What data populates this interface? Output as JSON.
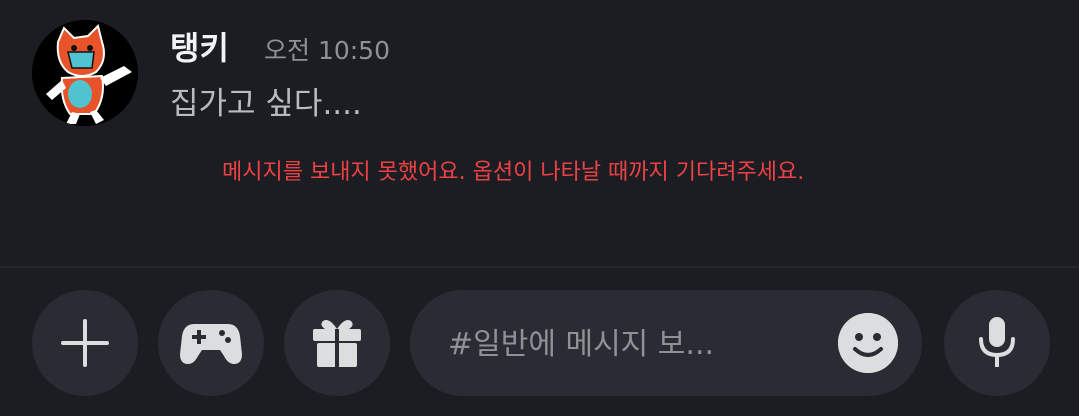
{
  "message": {
    "author": "탱키",
    "timestamp": "오전 10:50",
    "content": "집가고 싶다....",
    "error": "메시지를 보내지 못했어요. 옵션이 나타날 때까지 기다려주세요."
  },
  "composer": {
    "placeholder": "#일반에 메시지 보..."
  },
  "icons": {
    "add": "plus-icon",
    "games": "gamepad-icon",
    "gift": "gift-icon",
    "emoji": "smiley-icon",
    "voice": "microphone-icon"
  },
  "colors": {
    "background": "#1c1d22",
    "button": "#2a2c33",
    "error": "#ed4245",
    "author": "#f2f3f5",
    "timestamp": "#8e9297"
  }
}
